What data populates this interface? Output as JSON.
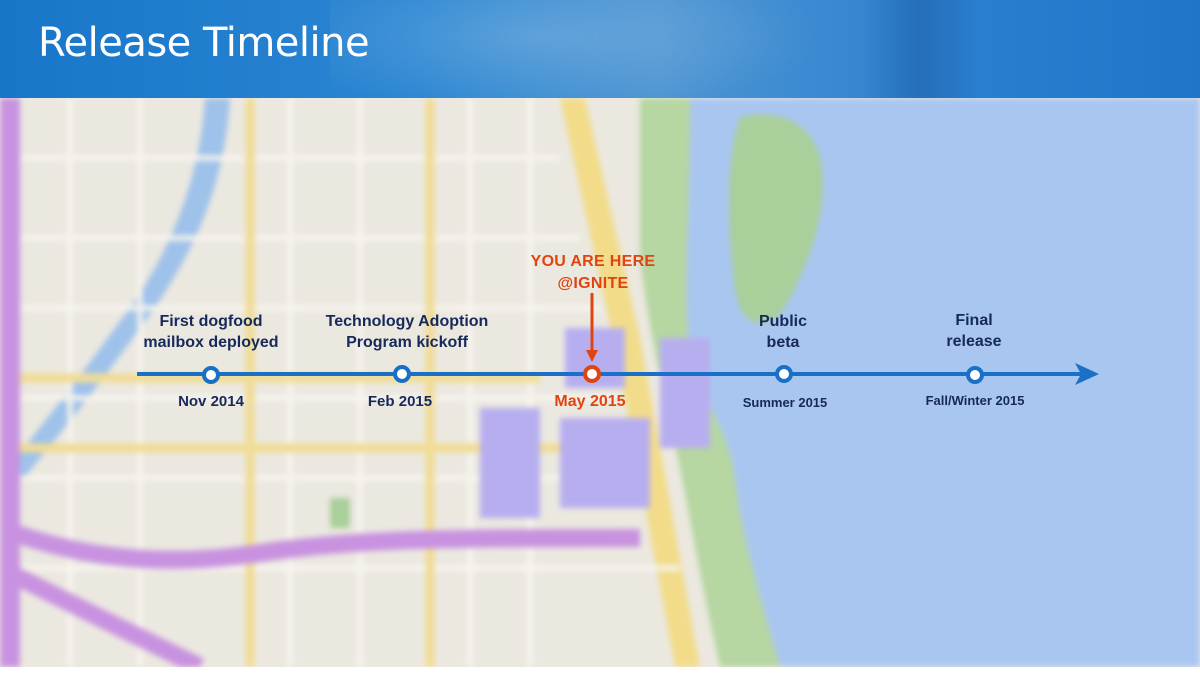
{
  "header": {
    "title": "Release Timeline",
    "background_color": "#1f78c8"
  },
  "timeline": {
    "line_color": "#1a6fc7",
    "highlight_color": "#e0440f",
    "current_marker": {
      "line1": "YOU ARE HERE",
      "line2": "@IGNITE"
    },
    "milestones": [
      {
        "label_line1": "First dogfood",
        "label_line2": "mailbox deployed",
        "date": "Nov 2014",
        "current": false
      },
      {
        "label_line1": "Technology Adoption",
        "label_line2": "Program kickoff",
        "date": "Feb 2015",
        "current": false
      },
      {
        "label_line1": "",
        "label_line2": "",
        "date": "May 2015",
        "current": true
      },
      {
        "label_line1": "Public",
        "label_line2": "beta",
        "date": "Summer 2015",
        "current": false
      },
      {
        "label_line1": "Final",
        "label_line2": "release",
        "date": "Fall/Winter 2015",
        "current": false
      }
    ]
  },
  "background": {
    "image": "blurred-city-map",
    "water_color": "#a9c6f0"
  }
}
